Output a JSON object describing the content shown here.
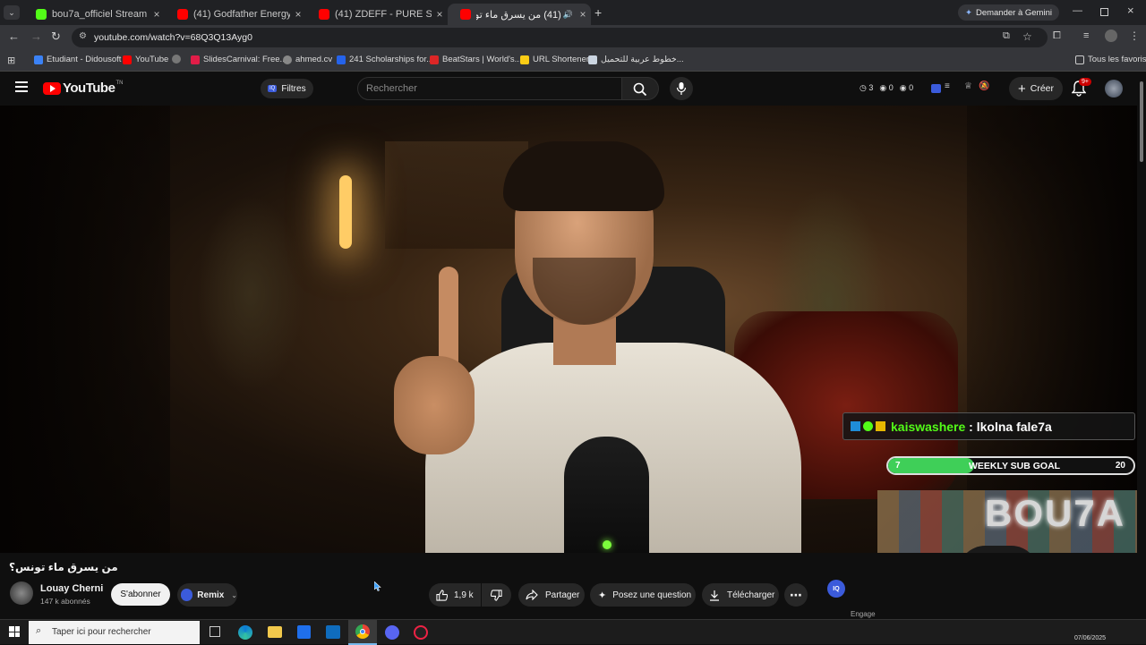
{
  "tabs": [
    {
      "title": "bou7a_officiel Stream - Watch Live",
      "favicon": "#53fc18"
    },
    {
      "title": "(41) Godfather Energy Jazz | Old",
      "favicon": "#ff0000"
    },
    {
      "title": "(41) ZDEFF - PURE SESSION (Lou",
      "favicon": "#ff0000"
    },
    {
      "title": "(41) من يسرق ماء تونس؟ - e",
      "favicon": "#ff0000"
    }
  ],
  "gemini_label": "Demander à Gemini",
  "address": {
    "url": "youtube.com/watch?v=68Q3Q13Ayg0"
  },
  "bookmarks": [
    {
      "label": "Etudiant - Didousoft",
      "color": "#3b82f6"
    },
    {
      "label": "YouTube",
      "color": "#ff0000"
    },
    {
      "label": "SlidesCarnival: Free...",
      "color": "#e11d48"
    },
    {
      "label": "ahmed.cv",
      "color": "#888888"
    },
    {
      "label": "241 Scholarships for...",
      "color": "#2563eb"
    },
    {
      "label": "BeatStars | World's...",
      "color": "#dc2626"
    },
    {
      "label": "URL Shortener",
      "color": "#facc15"
    },
    {
      "label": "خطوط عربية للتحميل...",
      "color": "#cbd5e1"
    }
  ],
  "all_bookmarks": "Tous les favoris",
  "youtube": {
    "logo": "YouTube",
    "logo_suffix": "TN",
    "filters": "Filtres",
    "search_placeholder": "Rechercher",
    "counters": [
      "3",
      "0",
      "0"
    ],
    "create": "Créer",
    "notif_badge": "9+"
  },
  "overlay": {
    "chat_user": "kaiswashere",
    "chat_sep": " : ",
    "chat_msg": "lkolna fale7a",
    "goal_label": "WEEKLY SUB GOAL",
    "goal_current": "7",
    "goal_target": "20",
    "goal_progress": 0.35,
    "cam_text": "BOU7A"
  },
  "video": {
    "title": "من يسرق ماء تونس؟",
    "channel": "Louay Cherni",
    "subscribers": "147 k abonnés",
    "subscribe": "S'abonner",
    "remix": "Remix",
    "likes": "1,9 k",
    "share": "Partager",
    "ask": "Posez une question",
    "download": "Télécharger",
    "iq": "IQ",
    "engage": "Engage"
  },
  "taskbar": {
    "search_placeholder": "Taper ici pour rechercher",
    "date": "07/06/2025"
  }
}
